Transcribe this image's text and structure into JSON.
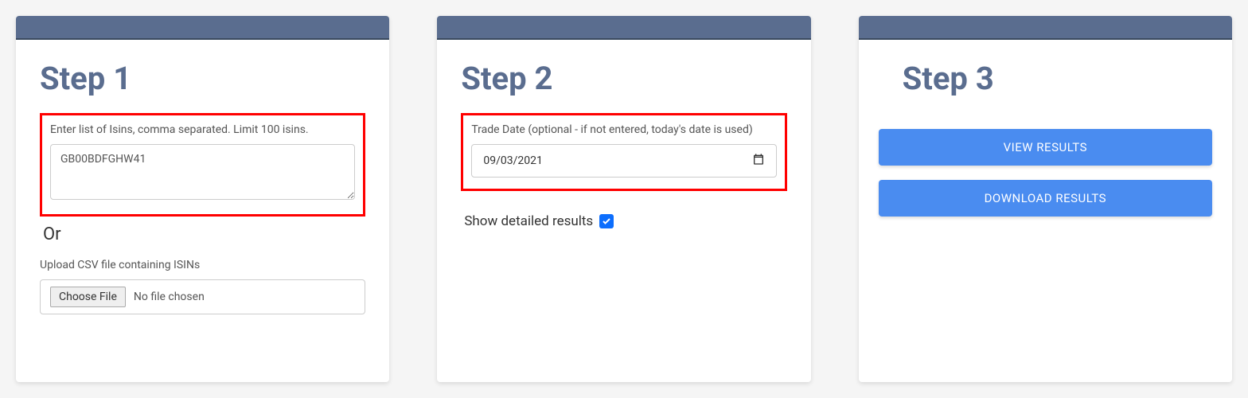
{
  "step1": {
    "title": "Step 1",
    "isin_label": "Enter list of Isins, comma separated. Limit 100 isins.",
    "isin_value": "GB00BDFGHW41",
    "or_text": "Or",
    "upload_label": "Upload CSV file containing ISINs",
    "choose_file_label": "Choose File",
    "file_status": "No file chosen"
  },
  "step2": {
    "title": "Step 2",
    "date_label": "Trade Date (optional - if not entered, today's date is used)",
    "date_value": "09/03/2021",
    "checkbox_label": "Show detailed results",
    "checkbox_checked": true
  },
  "step3": {
    "title": "Step 3",
    "view_results_label": "VIEW RESULTS",
    "download_results_label": "DOWNLOAD RESULTS"
  }
}
